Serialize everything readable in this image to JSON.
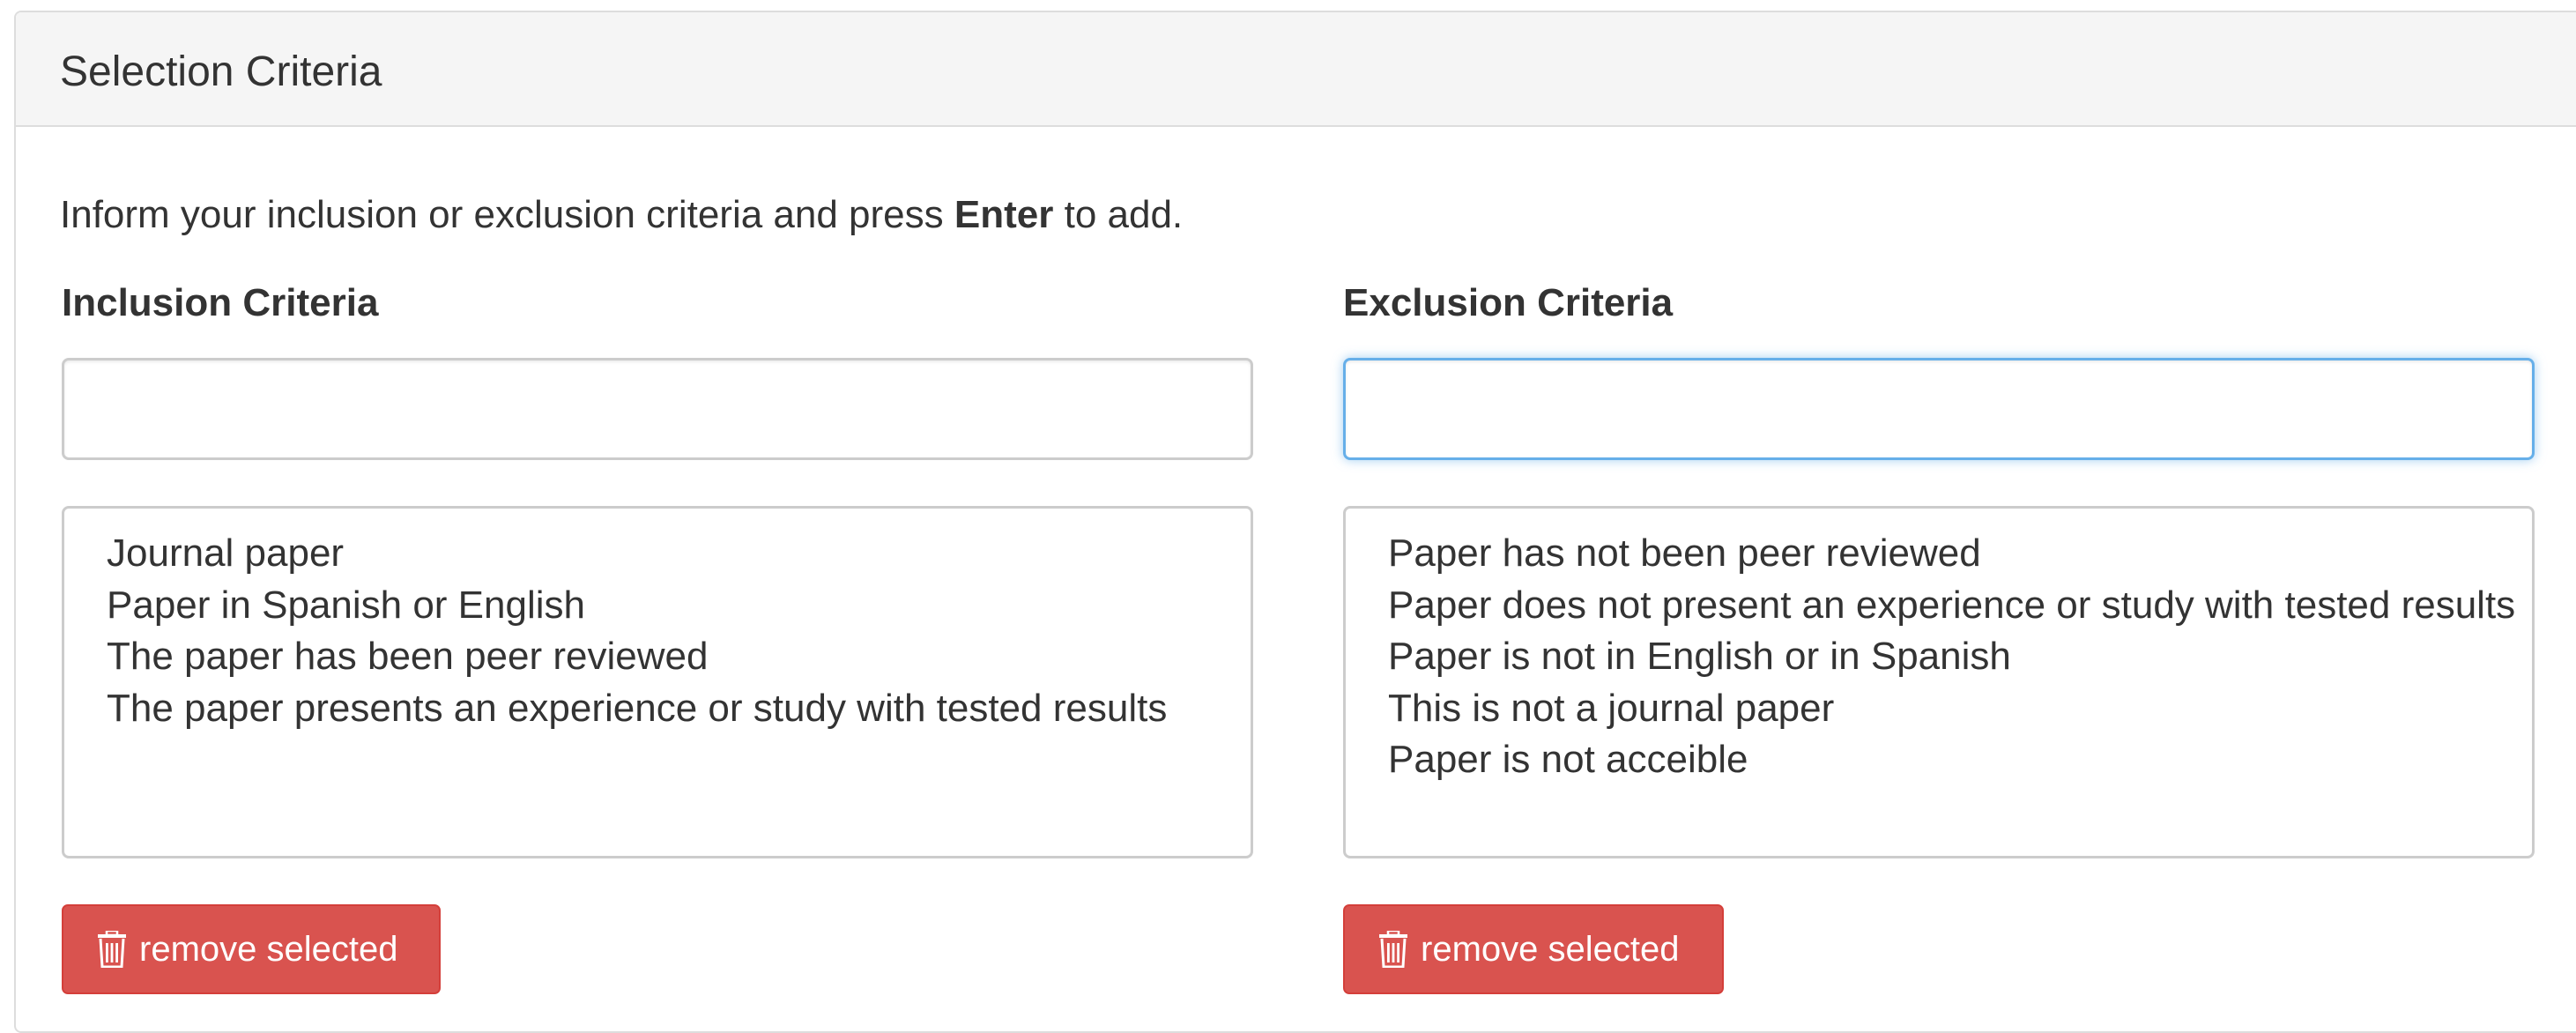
{
  "panel": {
    "title": "Selection Criteria"
  },
  "help": {
    "prefix": "Inform your inclusion or exclusion criteria and press ",
    "key": "Enter",
    "suffix": " to add."
  },
  "inclusion": {
    "label": "Inclusion Criteria",
    "input_value": "",
    "items": [
      "Journal paper",
      "Paper in Spanish or English",
      "The paper has been peer reviewed",
      "The paper presents an experience or study with tested results"
    ],
    "button_label": "remove selected",
    "button_icon": "trash-icon"
  },
  "exclusion": {
    "label": "Exclusion Criteria",
    "input_value": "",
    "input_focused": true,
    "items": [
      "Paper has not been peer reviewed",
      "Paper does not present an experience or study with tested results",
      "Paper is not in English or in Spanish",
      "This is not a journal paper",
      "Paper is not acceible"
    ],
    "button_label": "remove selected",
    "button_icon": "trash-icon"
  },
  "colors": {
    "danger": "#d9534f",
    "focus": "#66afe9",
    "heading_bg": "#f5f5f5"
  }
}
